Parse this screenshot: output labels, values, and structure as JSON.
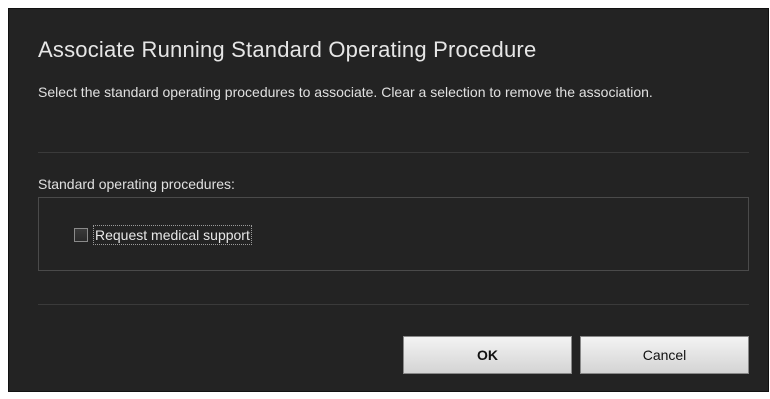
{
  "dialog": {
    "title": "Associate Running Standard Operating Procedure",
    "subtitle": "Select the standard operating procedures to associate. Clear a selection to remove the association.",
    "section_label": "Standard operating procedures:",
    "procedures": [
      {
        "label": "Request medical support",
        "checked": false
      }
    ],
    "buttons": {
      "ok_label": "OK",
      "cancel_label": "Cancel"
    }
  }
}
